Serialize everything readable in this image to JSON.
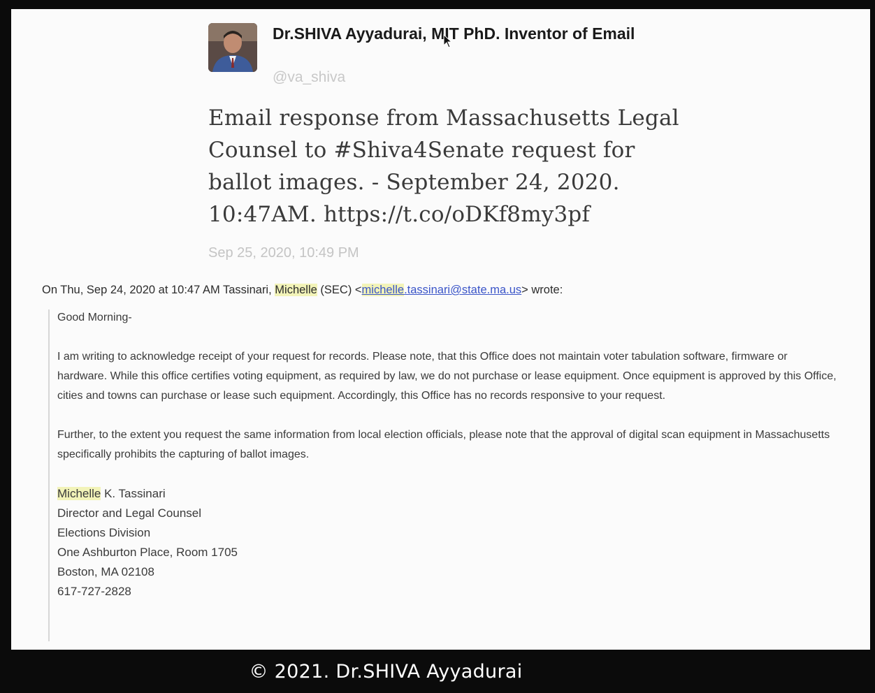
{
  "tweet": {
    "name": "Dr.SHIVA Ayyadurai, MIT PhD. Inventor of Email",
    "handle": "@va_shiva",
    "text": "Email response from Massachusetts Legal Counsel to #Shiva4Senate request for ballot images. - September 24, 2020. 10:47AM. https://t.co/oDKf8my3pf",
    "date": "Sep 25, 2020, 10:49 PM",
    "avatar_icon": "person-photo-icon"
  },
  "email": {
    "header_prefix": "On Thu, Sep 24, 2020 at 10:47 AM Tassinari,",
    "header_first_name": "Michelle",
    "header_sec": "(SEC) <",
    "header_email_highlight": "michelle",
    "header_email_rest": ".tassinari@state.ma.us",
    "header_suffix": "> wrote:",
    "greeting": "Good Morning-",
    "paragraph1": "I am writing to acknowledge receipt of your request for records. Please note, that this Office does not maintain voter tabulation software, firmware or hardware.  While this office certifies voting equipment, as required by law, we do not purchase or lease equipment.  Once equipment is approved by this Office, cities and towns can purchase or lease such equipment.  Accordingly, this Office has no records responsive to your request.",
    "paragraph2": "Further, to the extent you request the same information from local election officials, please note that the approval of digital scan equipment in Massachusetts specifically prohibits the capturing of ballot images.",
    "signature": {
      "first_name": "Michelle",
      "name_rest": " K. Tassinari",
      "title": "Director and Legal Counsel",
      "division": "Elections Division",
      "address1": "One Ashburton Place, Room 1705",
      "address2": "Boston, MA 02108",
      "phone": "617-727-2828"
    }
  },
  "footer": {
    "copyright": "© 2021. Dr.SHIVA Ayyadurai"
  },
  "colors": {
    "highlight": "#f2f3b8",
    "link": "#3b55c8",
    "background": "#fbfbfb",
    "frame": "#0b0b0b"
  }
}
